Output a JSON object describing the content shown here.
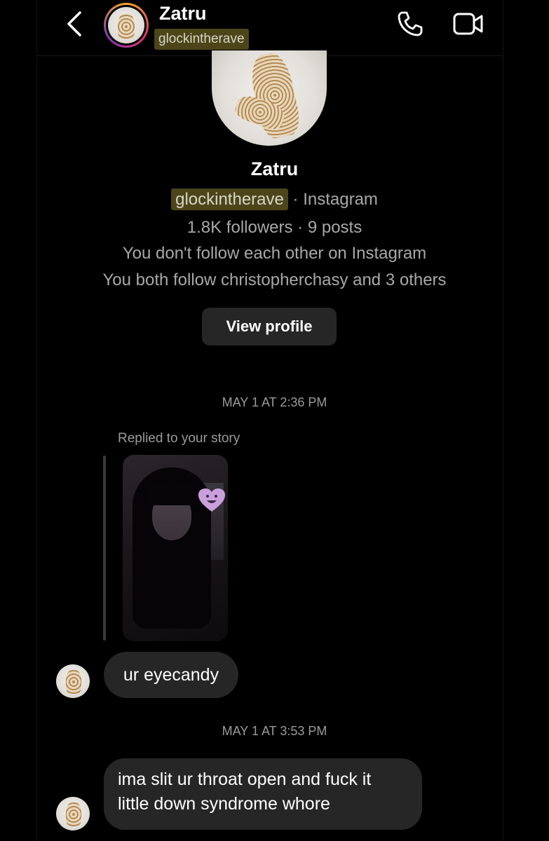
{
  "header": {
    "name": "Zatru",
    "username": "glockintherave",
    "icons": [
      "back-chevron-icon",
      "phone-icon",
      "video-camera-icon"
    ]
  },
  "profile": {
    "name": "Zatru",
    "username": "glockintherave",
    "platform": "· Instagram",
    "stats": "1.8K followers · 9 posts",
    "follow_status": "You don't follow each other on Instagram",
    "mutuals": "You both follow christopherchasy and 3 others",
    "view_profile_label": "View profile"
  },
  "thread": {
    "timestamp1": "MAY 1 AT 2:36 PM",
    "story_reply_label": "Replied to your story",
    "message1": "ur eyecandy",
    "timestamp2": "MAY 1 AT 3:53 PM",
    "message2_line1": "ima slit ur throat open and fuck it",
    "message2_line2": "little down syndrome whore"
  },
  "colors": {
    "background": "#000000",
    "bubble": "#262626",
    "highlight": "#4b4519",
    "muted_text": "#a8a8a8",
    "heart_sticker": "#c9a0dc"
  }
}
